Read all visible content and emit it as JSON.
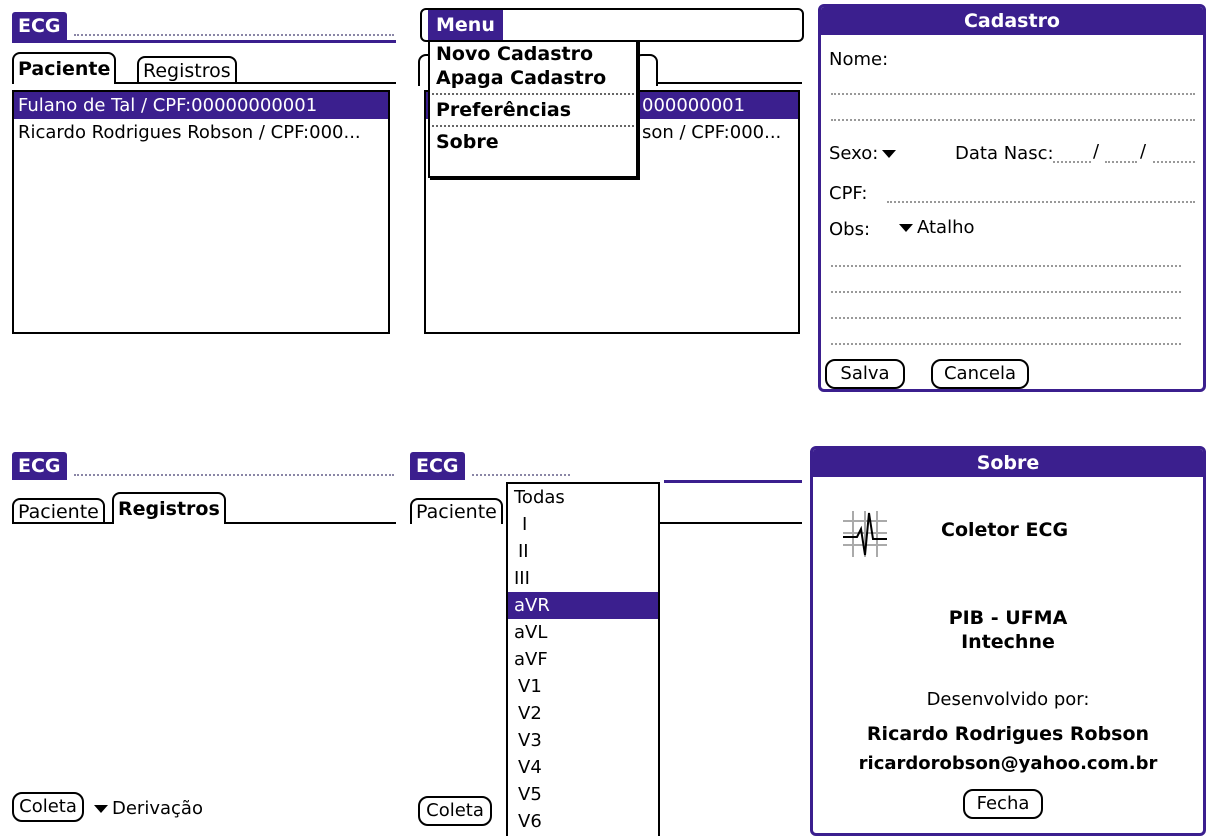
{
  "screen1": {
    "title": "ECG",
    "tab_paciente": "Paciente",
    "tab_registros": "Registros",
    "patients": [
      "Fulano de Tal / CPF:00000000001",
      "Ricardo Rodrigues Robson / CPF:000..."
    ]
  },
  "screen2": {
    "menu_title": "Menu",
    "menu_items": [
      "Novo Cadastro",
      "Apaga Cadastro",
      "Preferências",
      "Sobre"
    ],
    "patients_partial": [
      "000000001",
      "son / CPF:000..."
    ]
  },
  "screen3": {
    "title": "Cadastro",
    "nome_label": "Nome:",
    "sexo_label": "Sexo:",
    "data_nasc_label": "Data Nasc:",
    "date_sep1": "/",
    "date_sep2": "/",
    "cpf_label": "CPF:",
    "obs_label": "Obs:",
    "atalho_label": "Atalho",
    "salva_button": "Salva",
    "cancela_button": "Cancela"
  },
  "screen4": {
    "title": "ECG",
    "tab_paciente": "Paciente",
    "tab_registros": "Registros",
    "coleta_button": "Coleta",
    "derivacao_label": "Derivação"
  },
  "screen5": {
    "title": "ECG",
    "tab_paciente": "Paciente",
    "coleta_button": "Coleta",
    "leads": [
      "Todas",
      "I",
      "II",
      "III",
      "aVR",
      "aVL",
      "aVF",
      "V1",
      "V2",
      "V3",
      "V4",
      "V5",
      "V6"
    ],
    "selected_lead": "aVR"
  },
  "screen6": {
    "title": "Sobre",
    "app_name": "Coletor ECG",
    "org1": "PIB - UFMA",
    "org2": "Intechne",
    "developed_by": "Desenvolvido por:",
    "author": "Ricardo Rodrigues Robson",
    "email": "ricardorobson@yahoo.com.br",
    "fecha_button": "Fecha"
  },
  "colors": {
    "accent": "#3b1f8e"
  }
}
